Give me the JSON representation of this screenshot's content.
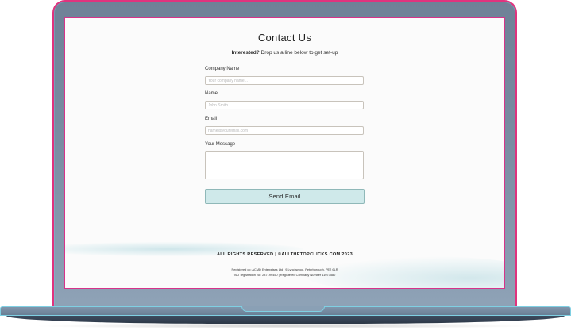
{
  "form": {
    "title": "Contact Us",
    "subtitle_bold": "Interested?",
    "subtitle_rest": " Drop us a line below to get set-up",
    "fields": [
      {
        "label": "Company Name",
        "placeholder": "Your company name..."
      },
      {
        "label": "Name",
        "placeholder": "John Smith"
      },
      {
        "label": "Email",
        "placeholder": "name@youremail.com"
      },
      {
        "label": "Your Message",
        "placeholder": ""
      }
    ],
    "submit_label": "Send Email"
  },
  "footer": {
    "rights": "ALL RIGHTS RESERVED | ©ALLTHETOPCLICKS.COM 2023",
    "registered": "Registered co: ACMD Enterprises Ltd | 9 Lynchwood, Peterborough, PE2 6LR",
    "vat": "VAT registration No: 287199450 | Registered Company Number 11073580"
  },
  "colors": {
    "accent_border": "#e0337e",
    "button_bg": "#cfe9ea",
    "laptop_body": "#7a8ca2"
  }
}
